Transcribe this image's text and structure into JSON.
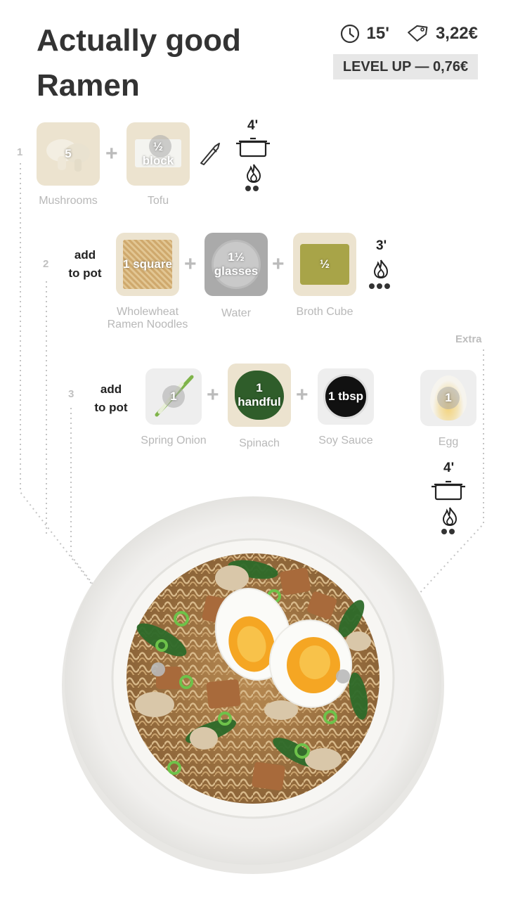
{
  "header": {
    "title_line1": "Actually good",
    "title_line2": "Ramen",
    "time": "15'",
    "price": "3,22€",
    "level_up": "LEVEL UP  —  0,76€"
  },
  "steps": [
    {
      "number": "1",
      "time": "4'",
      "ingredients": [
        {
          "qty": "5",
          "name": "Mushrooms"
        },
        {
          "qty_line1": "½",
          "qty_line2": "block",
          "name": "Tofu"
        }
      ]
    },
    {
      "number": "2",
      "action_line1": "add",
      "action_line2": "to pot",
      "time": "3'",
      "ingredients": [
        {
          "qty": "1 square",
          "name_line1": "Wholewheat",
          "name_line2": "Ramen Noodles"
        },
        {
          "qty_line1": "1½",
          "qty_line2": "glasses",
          "name": "Water"
        },
        {
          "qty": "½",
          "name": "Broth Cube"
        }
      ]
    },
    {
      "number": "3",
      "action_line1": "add",
      "action_line2": "to pot",
      "ingredients": [
        {
          "qty": "1",
          "name": "Spring Onion"
        },
        {
          "qty_line1": "1",
          "qty_line2": "handful",
          "name": "Spinach"
        },
        {
          "qty": "1 tbsp",
          "name": "Soy Sauce"
        }
      ]
    }
  ],
  "extra": {
    "label": "Extra",
    "time": "4'",
    "ingredient": {
      "qty": "1",
      "name": "Egg"
    }
  },
  "icons": [
    "clock-icon",
    "price-tag-icon",
    "knife-icon",
    "pot-icon",
    "flame-icon"
  ]
}
